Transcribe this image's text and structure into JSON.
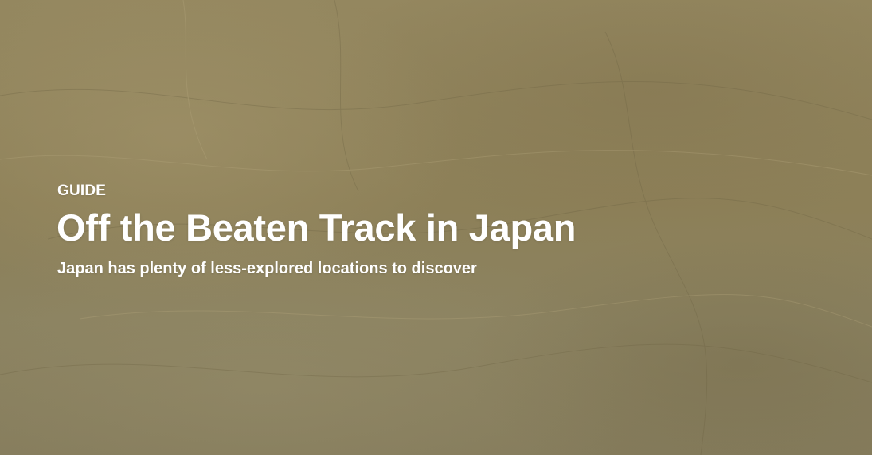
{
  "hero": {
    "eyebrow": "GUIDE",
    "title": "Off the Beaten Track in Japan",
    "subtitle": "Japan has plenty of less-explored locations to discover",
    "background_color": "#8f8259",
    "text_color": "#ffffff"
  }
}
